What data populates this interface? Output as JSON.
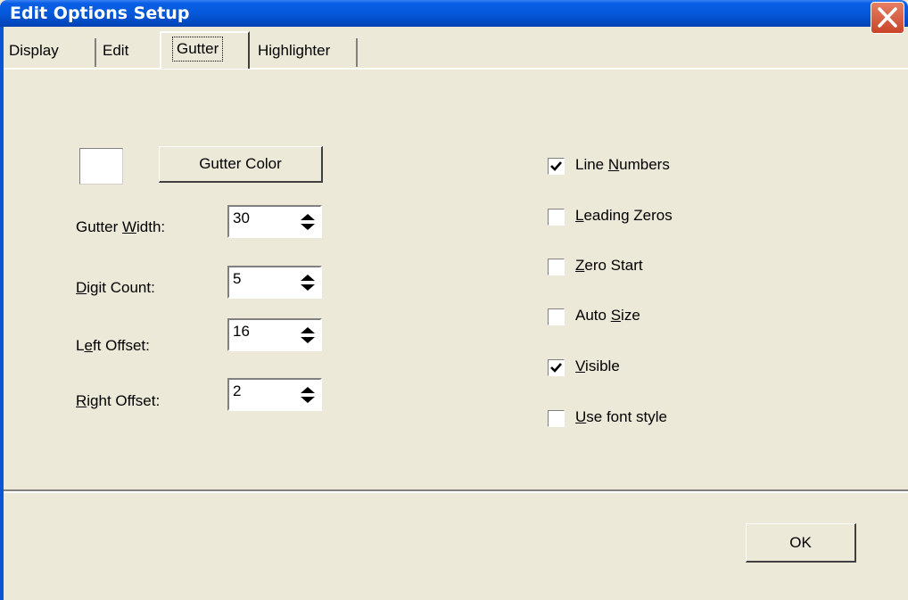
{
  "window": {
    "title": "Edit Options Setup"
  },
  "tabs": [
    {
      "label": "Display"
    },
    {
      "label": "Edit"
    },
    {
      "label": "Gutter",
      "selected": true
    },
    {
      "label": "Highlighter"
    }
  ],
  "gutter_color": {
    "button_label": "Gutter Color",
    "swatch_color": "#ffffff"
  },
  "fields": {
    "gutter_width": {
      "label_before": "Gutter ",
      "mnemonic": "W",
      "label_after": "idth:",
      "value": "30"
    },
    "digit_count": {
      "label_before": "",
      "mnemonic": "D",
      "label_after": "igit Count:",
      "value": "5"
    },
    "left_offset": {
      "label_before": "L",
      "mnemonic": "e",
      "label_after": "ft Offset:",
      "value": "16"
    },
    "right_offset": {
      "label_before": "",
      "mnemonic": "R",
      "label_after": "ight Offset:",
      "value": "2"
    }
  },
  "checkboxes": {
    "line_numbers": {
      "before": "Line ",
      "mnemonic": "N",
      "after": "umbers",
      "checked": true
    },
    "leading_zeros": {
      "before": "",
      "mnemonic": "L",
      "after": "eading Zeros",
      "checked": false
    },
    "zero_start": {
      "before": "",
      "mnemonic": "Z",
      "after": "ero Start",
      "checked": false
    },
    "auto_size": {
      "before": "Auto ",
      "mnemonic": "S",
      "after": "ize",
      "checked": false
    },
    "visible": {
      "before": "",
      "mnemonic": "V",
      "after": "isible",
      "checked": true
    },
    "use_font_style": {
      "before": "",
      "mnemonic": "U",
      "after": "se font style",
      "checked": false
    }
  },
  "ok_button": {
    "label": "OK"
  },
  "colors": {
    "title_bar": "#0458d9",
    "dialog_background": "#ece9d8",
    "close_button": "#d8603f"
  }
}
